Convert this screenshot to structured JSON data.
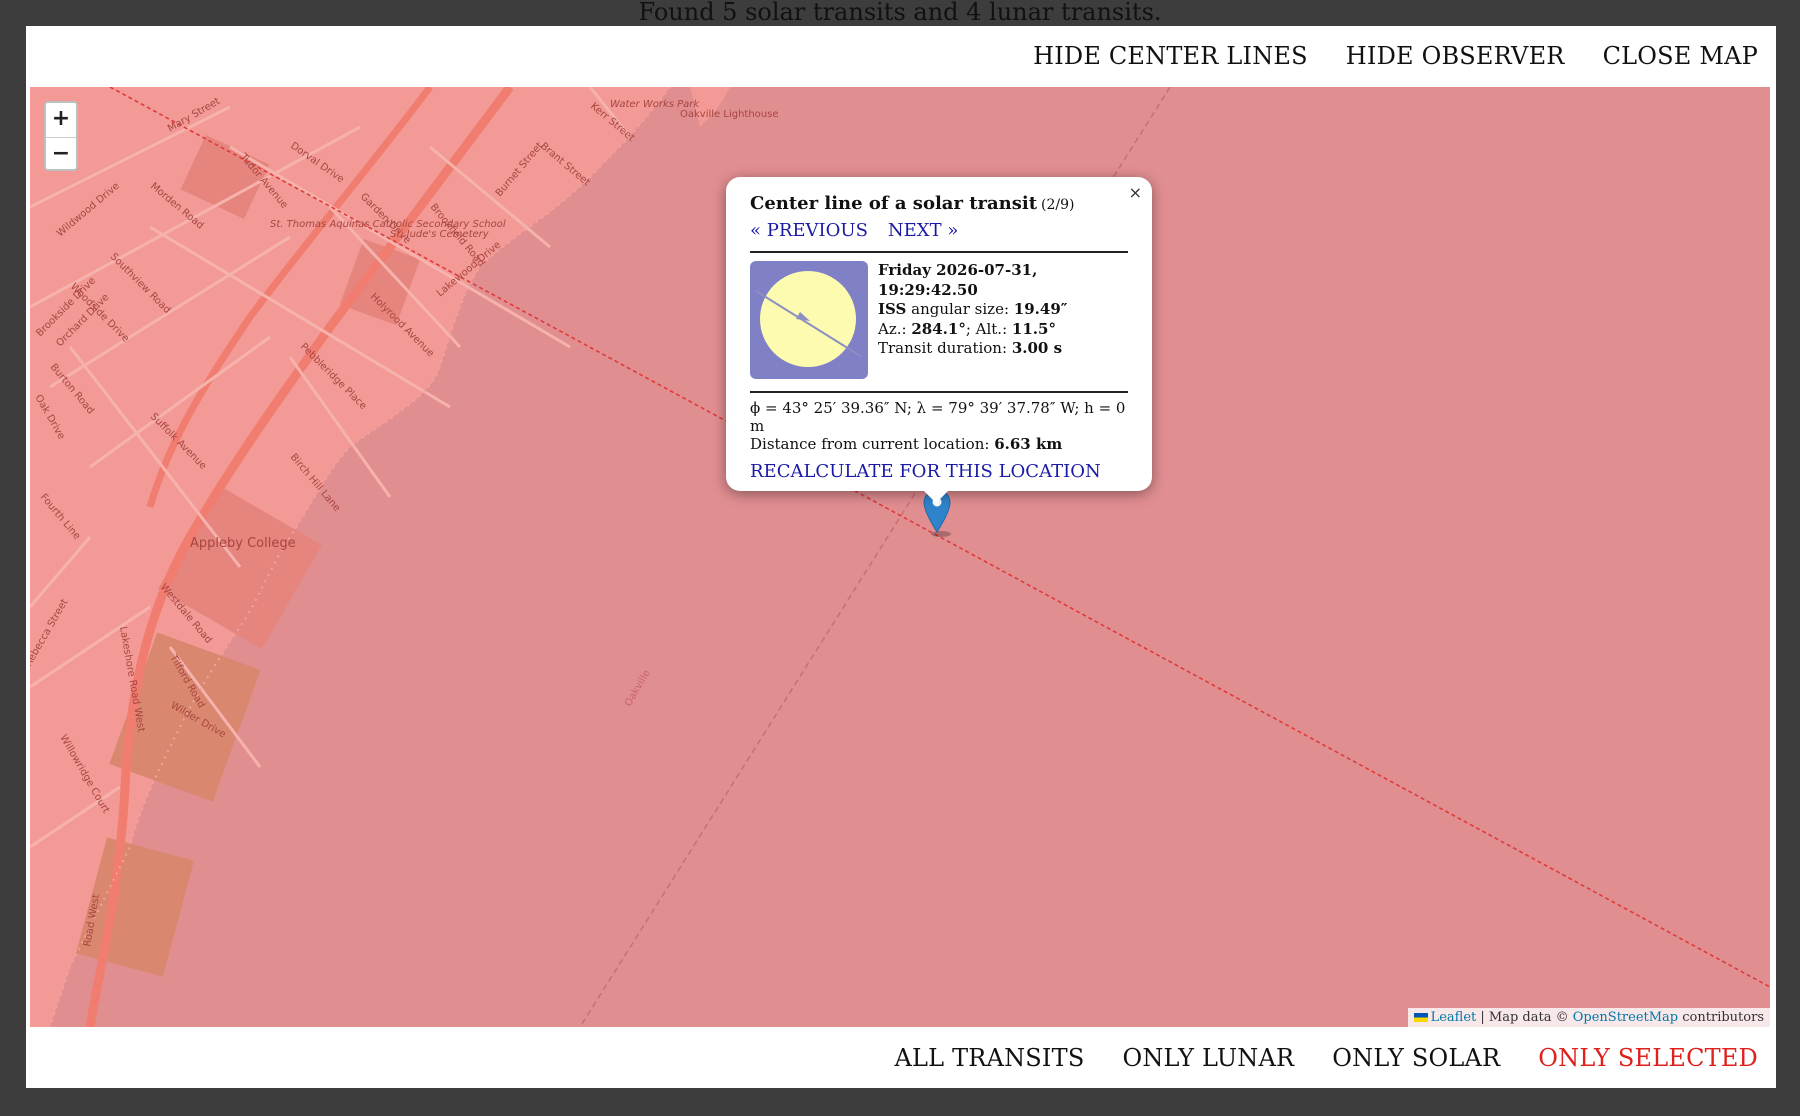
{
  "status_line": {
    "text": "Found 5 solar transits and 4 lunar transits."
  },
  "top_actions": {
    "hide_center_lines": "HIDE CENTER LINES",
    "hide_observer": "HIDE OBSERVER",
    "close_map": "CLOSE MAP"
  },
  "filters": {
    "all": "ALL TRANSITS",
    "lunar": "ONLY LUNAR",
    "solar": "ONLY SOLAR",
    "selected": "ONLY SELECTED",
    "active": "selected",
    "active_color": "#e0201c"
  },
  "map": {
    "zoom_in": "+",
    "zoom_out": "−",
    "overlay_color": "#e18e91",
    "labels": {
      "mary_street": "Mary Street",
      "dorval_drive": "Dorval Drive",
      "tudor_avenue": "Tudor Avenue",
      "morden_road": "Morden Road",
      "wildwood_drive": "Wildwood Drive",
      "garden_drive": "Garden Drive",
      "brookfield_road": "Brookfield Road",
      "burnet_street": "Burnet Street",
      "brant_street": "Brant Street",
      "kerr_street": "Kerr Street",
      "water_works_park": "Water Works Park",
      "oakville_lighthouse": "Oakville Lighthouse",
      "st_thomas": "St. Thomas Aquinas Catholic Secondary School",
      "st_judes": "St. Jude's Cemetery",
      "southview_road": "Southview Road",
      "woodside_drive": "Woodside Drive",
      "lakewood_drive": "Lakewood Drive",
      "holyrood_avenue": "Holyrood Avenue",
      "pebbleridge_place": "Pebbleridge Place",
      "brookside_drive": "Brookside Drive",
      "orchard_drive": "Orchard Drive",
      "burton_road": "Burton Road",
      "suffolk_avenue": "Suffolk Avenue",
      "birch_hill_lane": "Birch Hill Lane",
      "oak_drive": "Oak Drive",
      "fourth_line": "Fourth Line",
      "appleby_college": "Appleby College",
      "westdale_road": "Westdale Road",
      "tilford_road": "Tilford Road",
      "wilder_drive": "Wilder Drive",
      "lakeshore_road_west": "Lakeshore Road West",
      "rebecca_street": "Rebecca Street",
      "willowridge_court": "Willowridge Court",
      "oakville": "Oakville",
      "road_west": "Road West"
    },
    "attribution": {
      "leaflet": "Leaflet",
      "sep": "| Map data ©",
      "osm": "OpenStreetMap",
      "suffix": "contributors"
    }
  },
  "popup": {
    "close": "×",
    "title": "Center line of a solar transit",
    "counter": "(2/9)",
    "previous": "« PREVIOUS",
    "next": "NEXT »",
    "datetime": "Friday 2026-07-31, 19:29:42.50",
    "body_name": "ISS",
    "angular_label": "angular size:",
    "angular_value": "19.49″",
    "az_label": "Az.:",
    "az_value": "284.1°",
    "alt_label": "; Alt.:",
    "alt_value": "11.5°",
    "duration_label": "Transit duration:",
    "duration_value": "3.00 s",
    "coords": "ϕ = 43° 25′ 39.36″ N; λ = 79° 39′ 37.78″ W; h = 0 m",
    "distance_label": "Distance from current location:",
    "distance_value": "6.63 km",
    "recalculate": "RECALCULATE FOR THIS LOCATION"
  }
}
